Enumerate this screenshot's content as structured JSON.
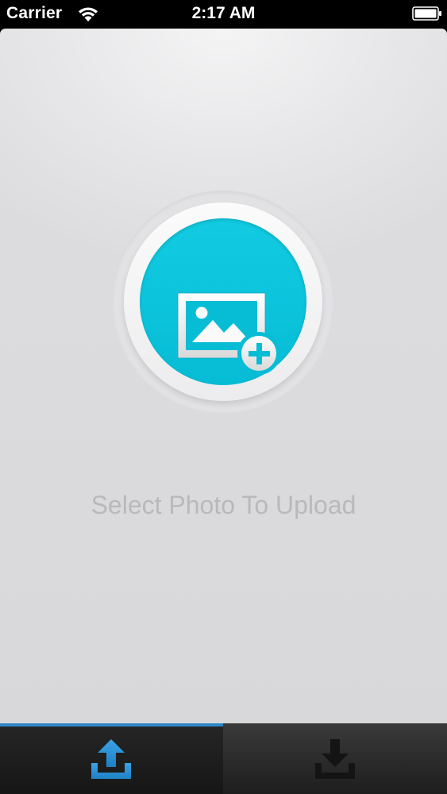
{
  "status_bar": {
    "carrier": "Carrier",
    "time": "2:17 AM",
    "icons": [
      "wifi-icon",
      "battery-icon"
    ]
  },
  "main": {
    "upload_button_icon": "add-photo-icon",
    "prompt": "Select Photo To Upload"
  },
  "tab_bar": {
    "tabs": [
      {
        "icon": "upload-icon",
        "selected": true
      },
      {
        "icon": "download-icon",
        "selected": false
      }
    ]
  },
  "colors": {
    "accent": "#06bcd5",
    "tab_selected": "#2f87c7",
    "tab_icon_inactive": "#1a1a1a",
    "prompt_text": "#b9b9bc"
  }
}
